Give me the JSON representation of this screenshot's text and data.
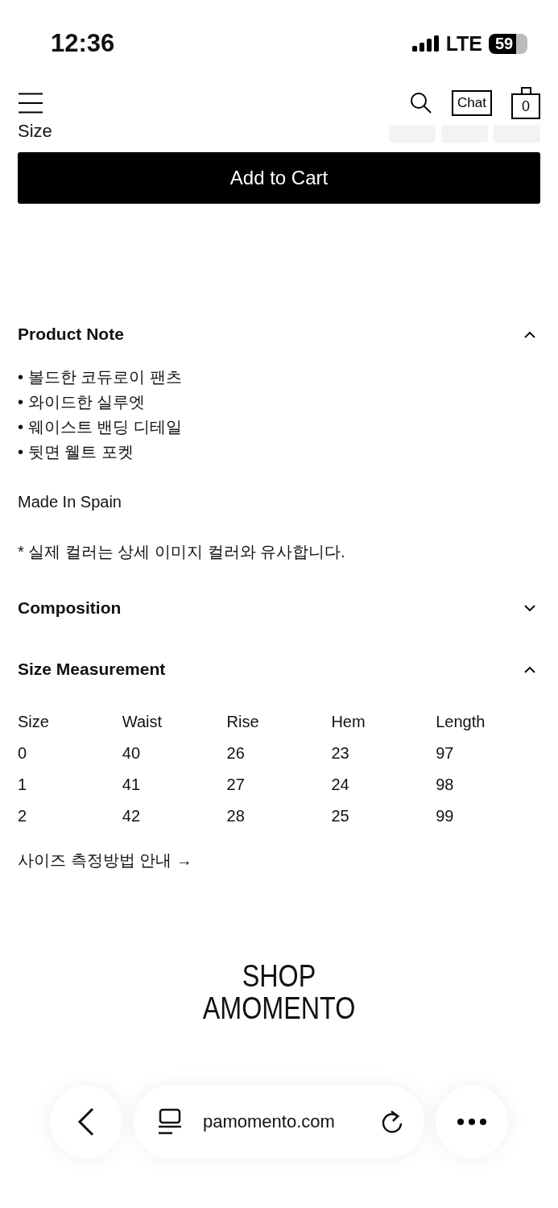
{
  "status_bar": {
    "time": "12:36",
    "network": "LTE",
    "battery": "59"
  },
  "header": {
    "chat": "Chat",
    "cart_count": "0"
  },
  "size_picker": {
    "label": "Size",
    "options": [
      {
        "selected": false
      },
      {
        "selected": false
      },
      {
        "selected": false
      }
    ]
  },
  "add_to_cart": "Add to Cart",
  "sections": [
    {
      "title": "Product Note",
      "expanded": true,
      "kind": "note",
      "bullets": [
        "• 볼드한 코듀로이 팬츠",
        "• 와이드한 실루엣",
        "• 웨이스트 밴딩 디테일",
        "• 뒷면 웰트 포켓"
      ],
      "origin": "Made In Spain",
      "remark": "* 실제 컬러는 상세 이미지 컬러와 유사합니다."
    },
    {
      "title": "Composition",
      "expanded": false
    },
    {
      "title": "Size Measurement",
      "expanded": true,
      "kind": "table",
      "columns": [
        "Size",
        "Waist",
        "Rise",
        "Hem",
        "Length"
      ],
      "rows": [
        [
          "0",
          "40",
          "26",
          "23",
          "97"
        ],
        [
          "1",
          "41",
          "27",
          "24",
          "98"
        ],
        [
          "2",
          "42",
          "28",
          "25",
          "99"
        ]
      ],
      "link": "사이즈 측정방법 안내 →"
    }
  ],
  "logo": [
    "SHOP",
    "AMOMENTO"
  ],
  "browser": {
    "url": "pamomento.com"
  }
}
